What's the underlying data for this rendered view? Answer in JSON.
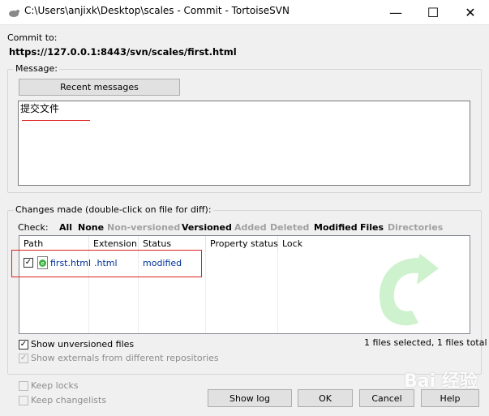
{
  "window": {
    "title": "C:\\Users\\anjixk\\Desktop\\scales - Commit - TortoiseSVN",
    "minimize": "—",
    "maximize": "☐",
    "close": "✕"
  },
  "commit": {
    "label": "Commit to:",
    "url": "https://127.0.0.1:8443/svn/scales/first.html"
  },
  "message": {
    "group_label": "Message:",
    "recent_button": "Recent messages",
    "text": "提交文件"
  },
  "changes": {
    "group_label": "Changes made (double-click on file for diff):",
    "check_label": "Check:",
    "filters": [
      {
        "label": "All",
        "enabled": true
      },
      {
        "label": "None",
        "enabled": true
      },
      {
        "label": "Non-versioned",
        "enabled": false
      },
      {
        "label": "Versioned",
        "enabled": true
      },
      {
        "label": "Added",
        "enabled": false
      },
      {
        "label": "Deleted",
        "enabled": false
      },
      {
        "label": "Modified",
        "enabled": true
      },
      {
        "label": "Files",
        "enabled": true
      },
      {
        "label": "Directories",
        "enabled": false
      }
    ],
    "columns": [
      "Path",
      "Extension",
      "Status",
      "Property status",
      "Lock"
    ],
    "rows": [
      {
        "checked": true,
        "path": "first.html",
        "extension": ".html",
        "status": "modified",
        "property_status": "",
        "lock": ""
      }
    ],
    "show_unversioned": "Show unversioned files",
    "show_externals": "Show externals from different repositories",
    "selection_summary": "1 files selected, 1 files total"
  },
  "options": {
    "keep_locks": "Keep locks",
    "keep_changelists": "Keep changelists"
  },
  "buttons": {
    "show_log": "Show log",
    "ok": "OK",
    "cancel": "Cancel",
    "help": "Help"
  },
  "watermark": "Bai 经验",
  "colors": {
    "annotation_red": "#e02020",
    "link_blue": "#003399",
    "watermark_green": "#6fcf6f"
  }
}
